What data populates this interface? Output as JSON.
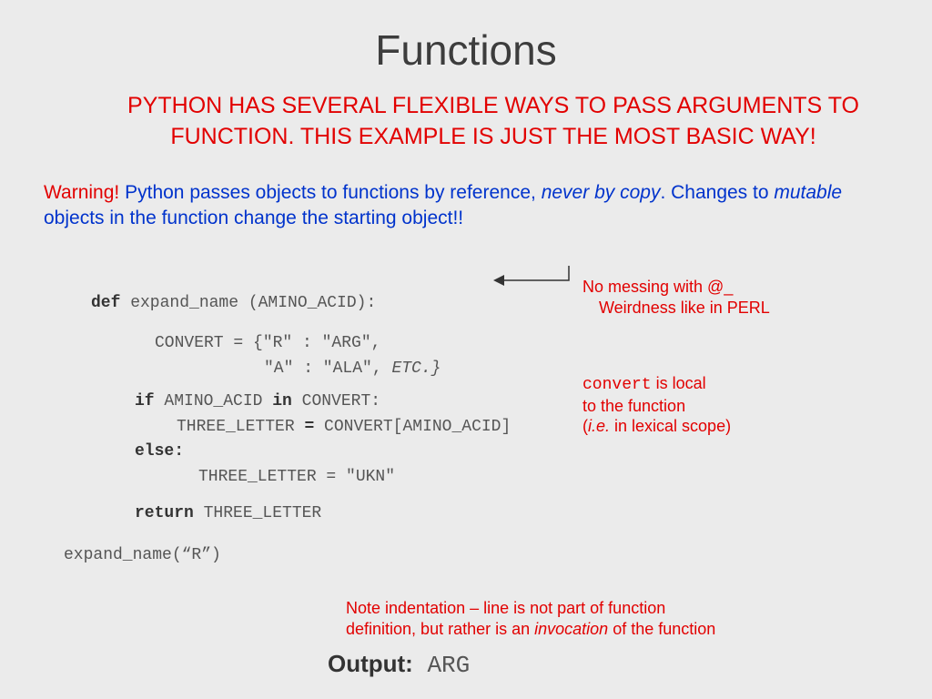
{
  "title": "Functions",
  "intro_line1": "PYTHON HAS SEVERAL FLEXIBLE WAYS TO PASS ARGUMENTS TO",
  "intro_line2": "FUNCTION. THIS EXAMPLE IS JUST THE MOST BASIC WAY!",
  "warning": {
    "label": "Warning!",
    "text1": " Python passes objects to functions by reference, ",
    "never": "never by copy",
    "text2": ". Changes to ",
    "mutable": "mutable",
    "text3": " objects in the function change the starting object!!"
  },
  "code": {
    "l1_def": "def",
    "l1_rest": " expand_name (AMINO_ACID):",
    "l2_a": "CONVERT = {\"R\" : \"ARG\",",
    "l2_b": "\"A\" : \"ALA\", ",
    "l2_etc": "ETC.}",
    "l3_if": "if",
    "l3_mid": " AMINO_ACID ",
    "l3_in": "in",
    "l3_rest": " CONVERT:",
    "l4_a": "THREE_LETTER ",
    "l4_eq": "=",
    "l4_b": " CONVERT[AMINO_ACID]",
    "l5_else": "else:",
    "l6": "THREE_LETTER = \"UKN\"",
    "l7_ret": "return",
    "l7_rest": " THREE_LETTER",
    "l8": "expand_name(“R”)"
  },
  "note1_l1": "No messing with @_",
  "note1_l2": "Weirdness like in PERL",
  "note2": {
    "convert": "convert",
    "rest1": " is local",
    "rest2": "to the function",
    "rest3a": "(",
    "ie": "i.e.",
    "rest3b": " in lexical scope)"
  },
  "note3_l1": "Note indentation – line is not part of function",
  "note3_l2a": "definition, but rather is an ",
  "note3_inv": "invocation",
  "note3_l2b": " of the function",
  "output_label": "Output:",
  "output_value": " ARG"
}
